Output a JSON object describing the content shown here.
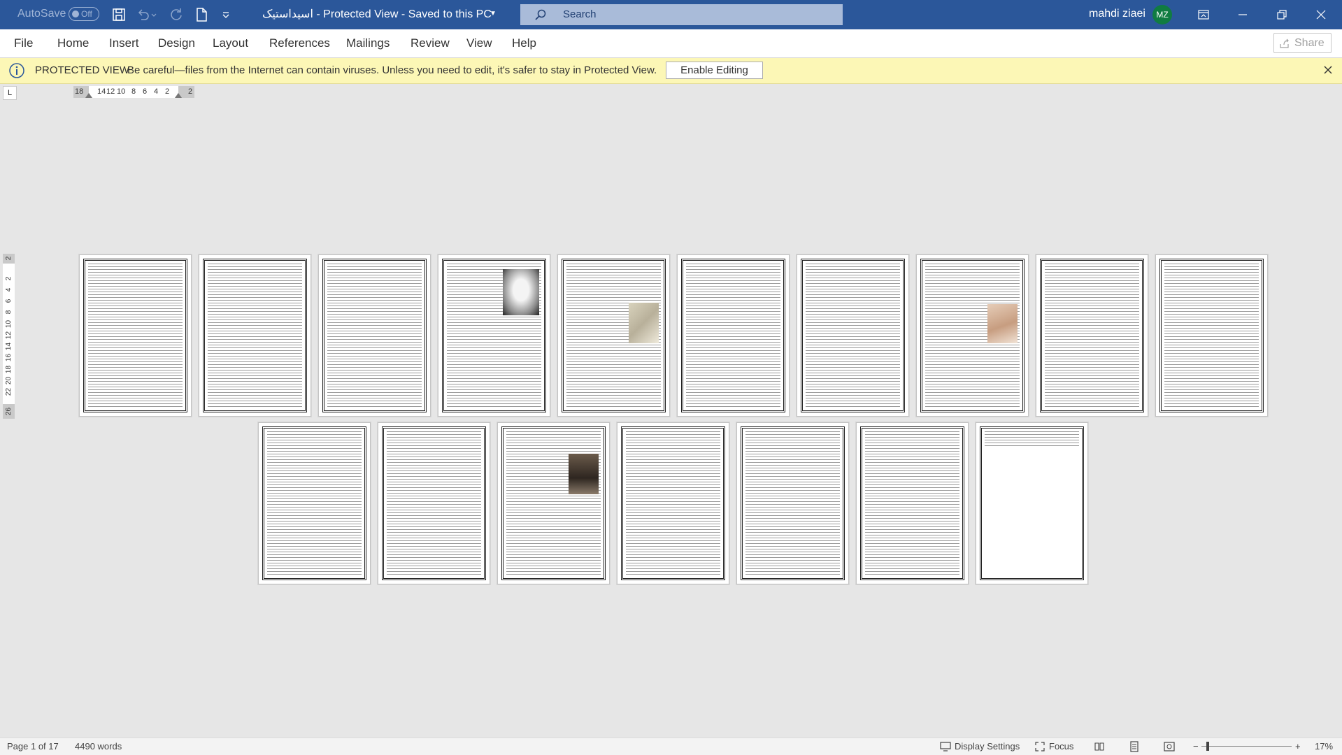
{
  "titlebar": {
    "autosave_label": "AutoSave",
    "autosave_state": "Off",
    "filename": "اسیداستیک",
    "separator1": "-",
    "view_mode": "Protected View",
    "separator2": "-",
    "save_status": "Saved to this PC",
    "search_placeholder": "Search",
    "user_name": "mahdi ziaei",
    "user_initials": "MZ"
  },
  "ribbon": {
    "tabs": [
      "File",
      "Home",
      "Insert",
      "Design",
      "Layout",
      "References",
      "Mailings",
      "Review",
      "View",
      "Help"
    ],
    "share_label": "Share"
  },
  "protected_view": {
    "title": "PROTECTED VIEW",
    "message": "Be careful—files from the Internet can contain viruses. Unless you need to edit, it's safer to stay in Protected View.",
    "enable_label": "Enable Editing"
  },
  "ruler": {
    "corner": "L",
    "horizontal_labels": [
      "18",
      "14",
      "12",
      "10",
      "8",
      "6",
      "4",
      "2",
      "2"
    ],
    "vertical_labels": [
      "2",
      "2",
      "4",
      "6",
      "8",
      "10",
      "12",
      "14",
      "16",
      "18",
      "20",
      "22",
      "26"
    ]
  },
  "document": {
    "page_count": 17
  },
  "statusbar": {
    "page_info": "Page 1 of 17",
    "word_count": "4490 words",
    "display_settings": "Display Settings",
    "focus": "Focus",
    "zoom_decrease": "−",
    "zoom_increase": "+",
    "zoom_level": "17%"
  },
  "colors": {
    "titlebar": "#2b579a",
    "protected_bar": "#fcf7b6",
    "avatar": "#107c41"
  }
}
